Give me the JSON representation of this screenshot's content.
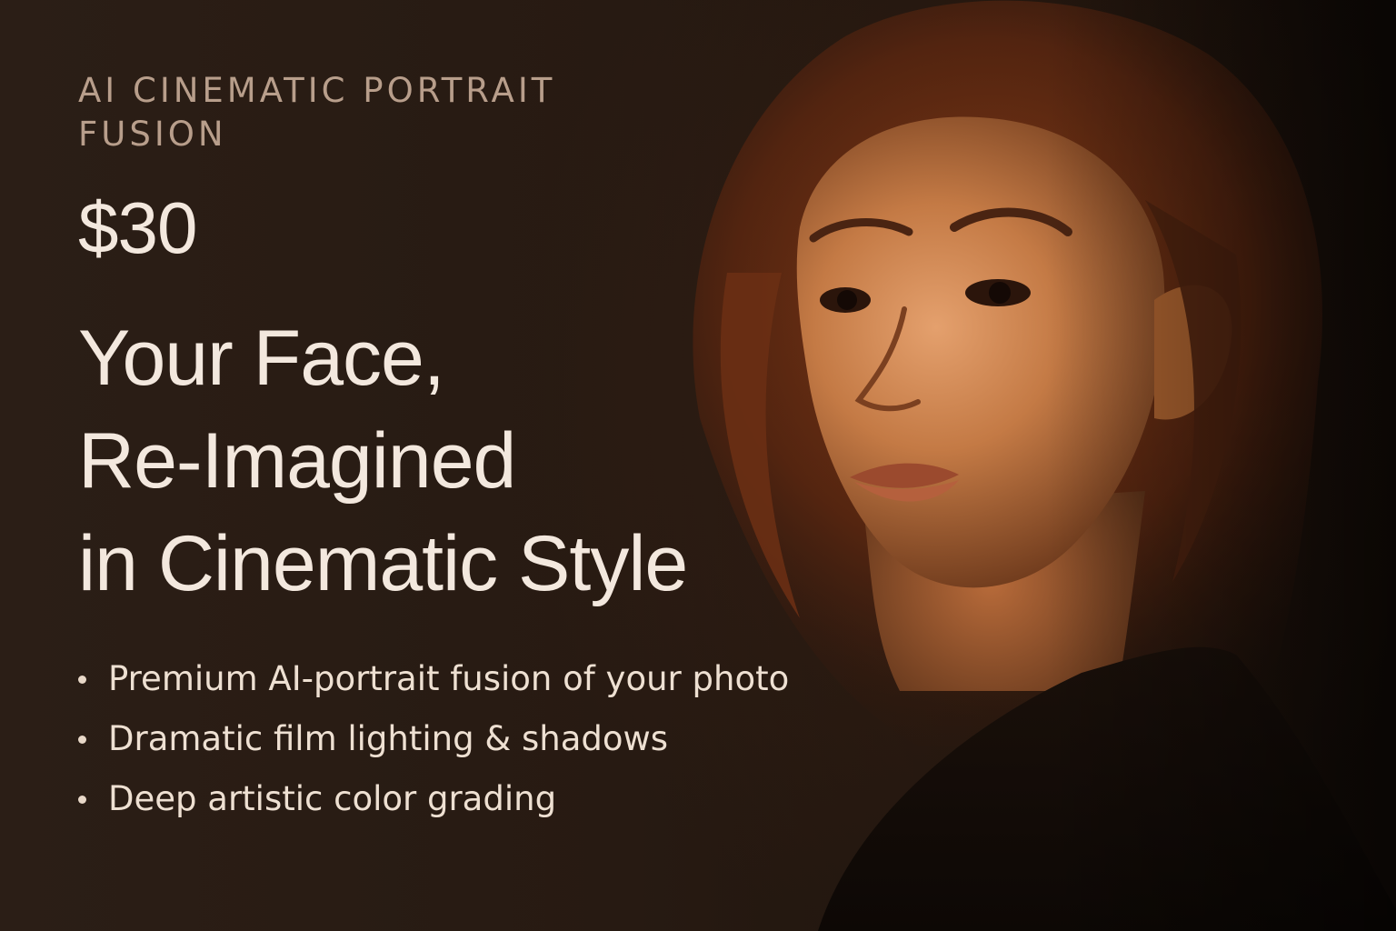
{
  "hero": {
    "eyebrow": "AI CINEMATIC PORTRAIT FUSION",
    "price": "$30",
    "headline_lines": [
      "Your Face,",
      "Re-Imagined",
      "in Cinematic Style"
    ],
    "features": [
      "Premium AI-portrait fusion of your photo",
      "Dramatic film lighting & shadows",
      "Deep artistic color grading"
    ]
  },
  "portrait": {
    "subject": "woman-portrait",
    "colors": {
      "background": "#24170f",
      "skin": "#c47a45",
      "hair": "#6a2f14",
      "shadow": "#120b07",
      "text_light": "#f3e8de",
      "text_muted": "#b89e8b"
    }
  }
}
